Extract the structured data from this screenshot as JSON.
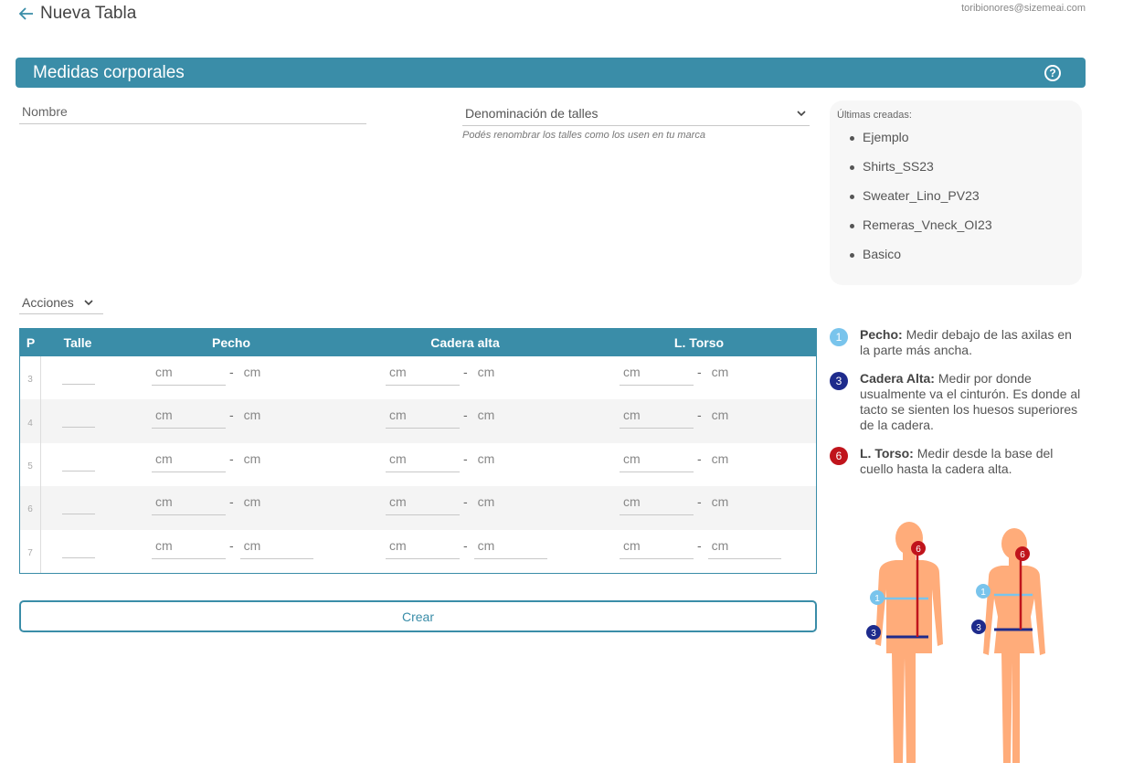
{
  "header": {
    "title": "Nueva Tabla",
    "user_email": "toribionores@sizemeai.com"
  },
  "section": {
    "title": "Medidas corporales"
  },
  "form": {
    "name_placeholder": "Nombre",
    "denominacion_label": "Denominación de talles",
    "denominacion_hint": "Podés renombrar los talles como los usen en tu marca"
  },
  "recent": {
    "heading": "Últimas creadas:",
    "items": [
      "Ejemplo",
      "Shirts_SS23",
      "Sweater_Lino_PV23",
      "Remeras_Vneck_OI23",
      "Basico"
    ]
  },
  "actions": {
    "label": "Acciones"
  },
  "table": {
    "headers": {
      "p": "P",
      "talle": "Talle",
      "pecho": "Pecho",
      "cadera": "Cadera alta",
      "torso": "L. Torso"
    },
    "unit": "cm",
    "separator": "-",
    "rows": [
      "3",
      "4",
      "5",
      "6",
      "7"
    ]
  },
  "submit": {
    "label": "Crear"
  },
  "legend": [
    {
      "num": "1",
      "color": "#79c4ec",
      "title": "Pecho:",
      "text": " Medir debajo de las axilas en la parte más ancha."
    },
    {
      "num": "3",
      "color": "#1e2b8c",
      "title": "Cadera Alta:",
      "text": " Medir por donde usualmente va el cinturón. Es donde al tacto se sienten los huesos superiores de la cadera."
    },
    {
      "num": "6",
      "color": "#c0141c",
      "title": "L. Torso:",
      "text": " Medir desde la base del cuello hasta la cadera alta."
    }
  ],
  "figure_markers": [
    "6",
    "1",
    "3",
    "6",
    "1",
    "3"
  ],
  "colors": {
    "accent": "#3a8da8",
    "skin": "#ffac7a",
    "pecho": "#79c4ec",
    "cadera": "#1e2b8c",
    "torso": "#c0141c"
  }
}
